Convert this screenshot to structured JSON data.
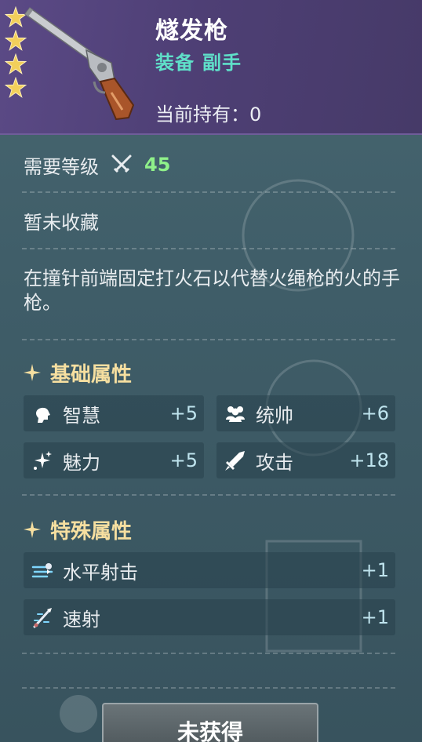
{
  "item": {
    "name": "燧发枪",
    "category": "装备",
    "slot": "副手",
    "owned_label": "当前持有：",
    "owned_count": "0",
    "stars": 4
  },
  "requirement": {
    "label": "需要等级",
    "icon": "crossed-swords-icon",
    "value": "45"
  },
  "collection_status": "暂未收藏",
  "description": "在撞针前端固定打火石以代替火绳枪的火的手枪。",
  "basic_attributes": {
    "title": "基础属性",
    "items": [
      {
        "icon": "head-icon",
        "label": "智慧",
        "value": "+5"
      },
      {
        "icon": "group-icon",
        "label": "统帅",
        "value": "+6"
      },
      {
        "icon": "sparkle-icon",
        "label": "魅力",
        "value": "+5"
      },
      {
        "icon": "sword-icon",
        "label": "攻击",
        "value": "+18"
      }
    ]
  },
  "special_attributes": {
    "title": "特殊属性",
    "items": [
      {
        "icon": "horizontal-shot-icon",
        "label": "水平射击",
        "value": "+1"
      },
      {
        "icon": "rapid-fire-icon",
        "label": "速射",
        "value": "+1"
      }
    ]
  },
  "action_button": "未获得",
  "colors": {
    "header_bg": "#5b4a86",
    "type_text": "#5fe0c9",
    "level_value": "#8ff08a",
    "section_title": "#f6dfa0",
    "star": "#f2cf5b"
  }
}
